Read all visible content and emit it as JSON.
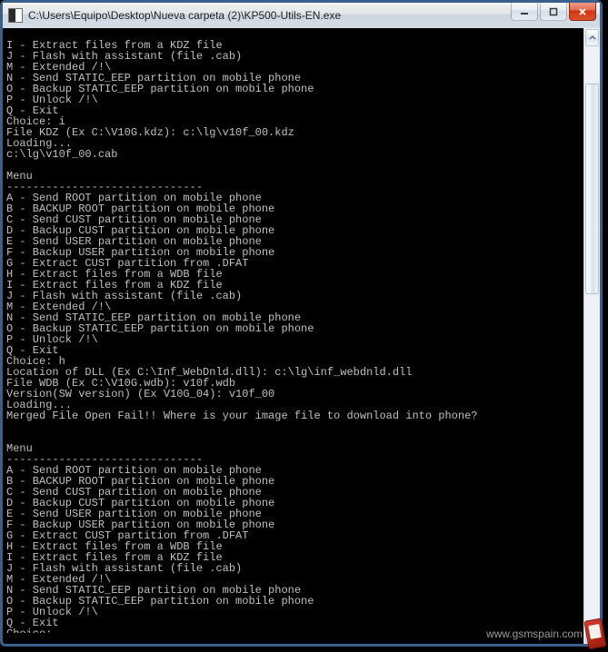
{
  "window": {
    "title": "C:\\Users\\Equipo\\Desktop\\Nueva carpeta (2)\\KP500-Utils-EN.exe"
  },
  "terminal": {
    "lines": [
      "I - Extract files from a KDZ file",
      "J - Flash with assistant (file .cab)",
      "M - Extended /!\\",
      "N - Send STATIC_EEP partition on mobile phone",
      "O - Backup STATIC_EEP partition on mobile phone",
      "P - Unlock /!\\",
      "Q - Exit",
      "Choice: i",
      "File KDZ (Ex C:\\V10G.kdz): c:\\lg\\v10f_00.kdz",
      "Loading...",
      "c:\\lg\\v10f_00.cab",
      "",
      "Menu",
      "------------------------------",
      "A - Send ROOT partition on mobile phone",
      "B - BACKUP ROOT partition on mobile phone",
      "C - Send CUST partition on mobile phone",
      "D - Backup CUST partition on mobile phone",
      "E - Send USER partition on mobile phone",
      "F - Backup USER partition on mobile phone",
      "G - Extract CUST partition from .DFAT",
      "H - Extract files from a WDB file",
      "I - Extract files from a KDZ file",
      "J - Flash with assistant (file .cab)",
      "M - Extended /!\\",
      "N - Send STATIC_EEP partition on mobile phone",
      "O - Backup STATIC_EEP partition on mobile phone",
      "P - Unlock /!\\",
      "Q - Exit",
      "Choice: h",
      "Location of DLL (Ex C:\\Inf_WebDnld.dll): c:\\lg\\inf_webdnld.dll",
      "File WDB (Ex C:\\V10G.wdb): v10f.wdb",
      "Version(SW version) (Ex V10G_04): v10f_00",
      "Loading...",
      "Merged File Open Fail!! Where is your image file to download into phone?",
      "",
      "",
      "Menu",
      "------------------------------",
      "A - Send ROOT partition on mobile phone",
      "B - BACKUP ROOT partition on mobile phone",
      "C - Send CUST partition on mobile phone",
      "D - Backup CUST partition on mobile phone",
      "E - Send USER partition on mobile phone",
      "F - Backup USER partition on mobile phone",
      "G - Extract CUST partition from .DFAT",
      "H - Extract files from a WDB file",
      "I - Extract files from a KDZ file",
      "J - Flash with assistant (file .cab)",
      "M - Extended /!\\",
      "N - Send STATIC_EEP partition on mobile phone",
      "O - Backup STATIC_EEP partition on mobile phone",
      "P - Unlock /!\\",
      "Q - Exit",
      "Choice:"
    ]
  },
  "watermark": {
    "text": "www.gsmspain.com"
  }
}
